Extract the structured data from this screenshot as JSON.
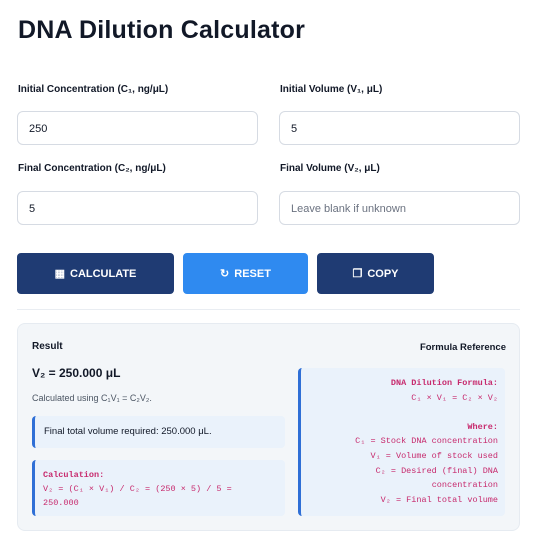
{
  "title": "DNA Dilution Calculator",
  "fields": {
    "c1": {
      "label": "Initial Concentration (C₁, ng/μL)",
      "value": "250"
    },
    "v1": {
      "label": "Initial Volume (V₁, μL)",
      "value": "5"
    },
    "c2": {
      "label": "Final Concentration (C₂, ng/μL)",
      "value": "5"
    },
    "v2": {
      "label": "Final Volume (V₂, μL)",
      "placeholder": "Leave blank if unknown"
    }
  },
  "buttons": {
    "calculate": {
      "label": "CALCULATE",
      "icon": "calculator-icon"
    },
    "reset": {
      "label": "RESET",
      "icon": "reset-icon"
    },
    "copy": {
      "label": "COPY",
      "icon": "copy-icon"
    }
  },
  "result": {
    "heading": "Result",
    "value": "V₂ = 250.000 μL",
    "method": "Calculated using C₁V₁ = C₂V₂.",
    "note": "Final total volume required: 250.000 μL.",
    "calc_title": "Calculation:",
    "calc_line1": "V₂ = (C₁ × V₁) / C₂ = (250 × 5) / 5 =",
    "calc_line2": "250.000"
  },
  "formula": {
    "heading": "Formula Reference",
    "title": "DNA Dilution Formula:",
    "equation": "C₁ × V₁ = C₂ × V₂",
    "where": "Where:",
    "lines": [
      "C₁ = Stock DNA concentration",
      "V₁ = Volume of stock used",
      "C₂ = Desired (final) DNA",
      "concentration",
      "V₂ = Final total volume"
    ]
  },
  "colors": {
    "primary_dark": "#1f3b73",
    "primary_blue": "#2f8af0",
    "code_pink": "#c72a6d"
  }
}
